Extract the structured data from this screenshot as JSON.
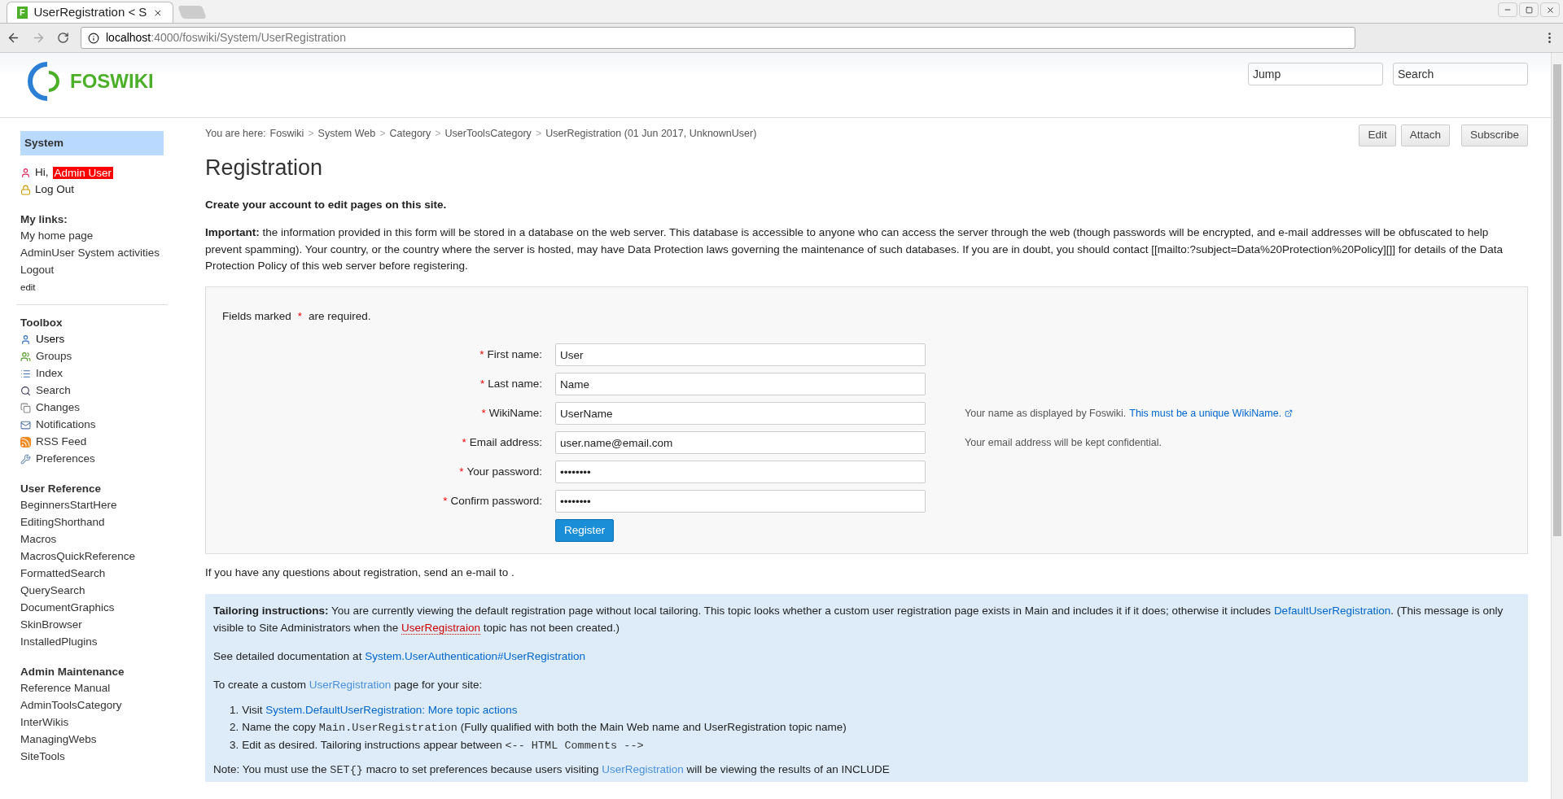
{
  "browser": {
    "favicon": "F",
    "tab_title": "UserRegistration < S",
    "url_host": "localhost",
    "url_rest": ":4000/foswiki/System/UserRegistration"
  },
  "header": {
    "logo": "FOSWIKI",
    "jump": {
      "placeholder": "Jump"
    },
    "search": {
      "placeholder": "Search"
    }
  },
  "sidebar": {
    "web": "System",
    "greeting": "Hi,",
    "user": "Admin User",
    "logout": "Log Out",
    "sections": [
      {
        "title": "My links:",
        "items": [
          {
            "label": "My home page",
            "small": false
          },
          {
            "label": "AdminUser System activities",
            "small": false
          },
          {
            "label": "Logout",
            "small": false
          },
          {
            "label": "edit",
            "small": true
          }
        ]
      },
      {
        "title": "Toolbox",
        "items": [
          {
            "label": "Users"
          },
          {
            "label": "Groups"
          },
          {
            "label": "Index"
          },
          {
            "label": "Search"
          },
          {
            "label": "Changes"
          },
          {
            "label": "Notifications"
          },
          {
            "label": "RSS Feed"
          },
          {
            "label": "Preferences"
          }
        ]
      },
      {
        "title": "User Reference",
        "items": [
          {
            "label": "BeginnersStartHere"
          },
          {
            "label": "EditingShorthand"
          },
          {
            "label": "Macros"
          },
          {
            "label": "MacrosQuickReference"
          },
          {
            "label": "FormattedSearch"
          },
          {
            "label": "QuerySearch"
          },
          {
            "label": "DocumentGraphics"
          },
          {
            "label": "SkinBrowser"
          },
          {
            "label": "InstalledPlugins"
          }
        ]
      },
      {
        "title": "Admin Maintenance",
        "items": [
          {
            "label": "Reference Manual"
          },
          {
            "label": "AdminToolsCategory"
          },
          {
            "label": "InterWikis"
          },
          {
            "label": "ManagingWebs"
          },
          {
            "label": "SiteTools"
          }
        ]
      }
    ]
  },
  "breadcrumbs": {
    "prefix": "You are here:",
    "items": [
      {
        "label": "Foswiki",
        "separator": ">"
      },
      {
        "label": "System Web",
        "separator": ">"
      },
      {
        "label": "Category",
        "separator": ">"
      },
      {
        "label": "UserToolsCategory",
        "separator": ">"
      }
    ],
    "current": "UserRegistration (01 Jun 2017, UnknownUser)"
  },
  "actions": [
    "Edit",
    "Attach",
    "Subscribe"
  ],
  "title": "Registration",
  "intro": "Create your account to edit pages on this site.",
  "important": "**Important:** the information provided in this form will be stored in a database on the web server. This database is accessible to anyone who can access the server through the web (though passwords will be encrypted, and e-mail addresses will be obfuscated to help prevent spamming). Your country, or the country where the server is hosted, may have Data Protection laws governing the maintenance of such databases. If you are in doubt, you should contact [[mailto:?subject=Data%20Protection%20Policy][]] for details of the Data Protection Policy of this web server before registering.",
  "form": {
    "required_note": [
      "Fields marked",
      "*",
      "are required."
    ],
    "fields": [
      {
        "label": "First name:",
        "value": "User",
        "required": true
      },
      {
        "label": "Last name:",
        "value": "Name",
        "required": true
      },
      {
        "label": "WikiName:",
        "value": "UserName",
        "required": true,
        "hint": "Your name as displayed by Foswiki.",
        "hint_link": "This must be a unique WikiName."
      },
      {
        "label": "Email address:",
        "value": "user.name@email.com",
        "required": true,
        "hint": "Your email address will be kept confidential."
      },
      {
        "label": "Your password:",
        "value": "••••••••",
        "required": true
      },
      {
        "label": "Confirm password:",
        "value": "••••••••",
        "required": true
      }
    ],
    "submit": "Register"
  },
  "questions": "If you have any questions about registration, send an e-mail to .",
  "tailoring": [
    [
      {
        "kind": "bold",
        "text": "Tailoring instructions:"
      },
      {
        "kind": "text",
        "text": " You are currently viewing the default registration page without local tailoring. This topic looks whether a custom user registration page exists in Main and includes it if it does; otherwise it includes "
      },
      {
        "kind": "link",
        "text": "DefaultUserRegistration"
      },
      {
        "kind": "text",
        "text": ". (This message is only visible to Site Administrators when the "
      },
      {
        "kind": "missing",
        "text": "UserRegistraion"
      },
      {
        "kind": "text",
        "text": " topic has not been created.)"
      }
    ],
    [
      {
        "kind": "text",
        "text": "See detailed documentation at "
      },
      {
        "kind": "link",
        "text": "System.UserAuthentication#UserRegistration"
      }
    ],
    [
      {
        "kind": "text",
        "text": "To create a custom "
      },
      {
        "kind": "self",
        "text": "UserRegistration"
      },
      {
        "kind": "text",
        "text": " page for your site:"
      }
    ]
  ],
  "steps": [
    {
      "number": "1.",
      "segments": [
        {
          "kind": "text",
          "text": "Visit "
        },
        {
          "kind": "link",
          "text": "System.DefaultUserRegistration: More topic actions"
        }
      ]
    },
    {
      "number": "2.",
      "segments": [
        {
          "kind": "text",
          "text": "Name the copy "
        },
        {
          "kind": "code",
          "text": "Main.UserRegistration"
        },
        {
          "kind": "text",
          "text": " (Fully qualified with both the Main Web name and UserRegistration topic name)"
        }
      ]
    },
    {
      "number": "3.",
      "segments": [
        {
          "kind": "text",
          "text": "Edit as desired. Tailoring instructions appear between "
        },
        {
          "kind": "code",
          "text": "<-- HTML Comments -->"
        }
      ]
    }
  ],
  "note": [
    {
      "kind": "text",
      "text": "Note: You must use the "
    },
    {
      "kind": "code",
      "text": "SET{}"
    },
    {
      "kind": "text",
      "text": " macro to set preferences because users visiting "
    },
    {
      "kind": "self",
      "text": "UserRegistration"
    },
    {
      "kind": "text",
      "text": " will be viewing the results of an INCLUDE"
    }
  ]
}
